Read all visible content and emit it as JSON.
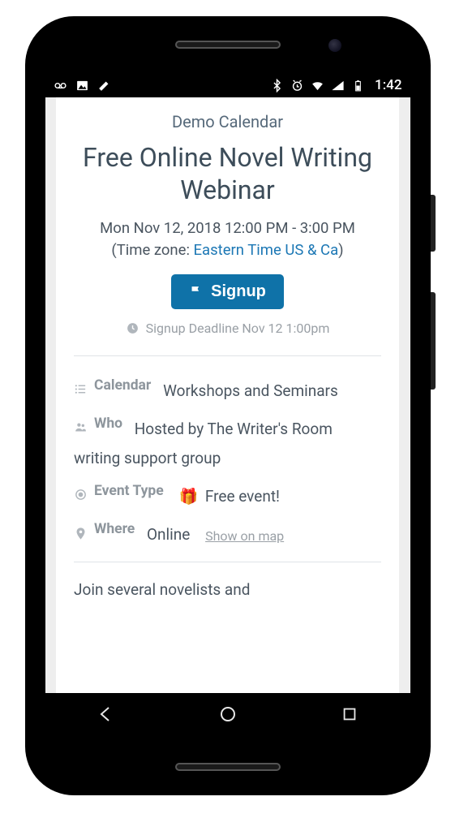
{
  "statusbar": {
    "time": "1:42"
  },
  "header": {
    "breadcrumb": "Demo Calendar",
    "title": "Free Online Novel Writing Webinar",
    "datetime": "Mon Nov 12, 2018 12:00 PM - 3:00 PM",
    "tz_prefix": "(Time zone: ",
    "tz_link": "Eastern Time US & Ca",
    "tz_suffix": ")"
  },
  "signup": {
    "label": "Signup",
    "deadline": "Signup Deadline Nov 12 1:00pm"
  },
  "info": {
    "calendar_label": "Calendar",
    "calendar_value": "Workshops and Seminars",
    "who_label": "Who",
    "who_value": "Hosted by The Writer's Room writing support group",
    "type_label": "Event Type",
    "type_value": "Free event!",
    "where_label": "Where",
    "where_value": "Online",
    "map_link": "Show on map"
  },
  "description": "Join several novelists and"
}
